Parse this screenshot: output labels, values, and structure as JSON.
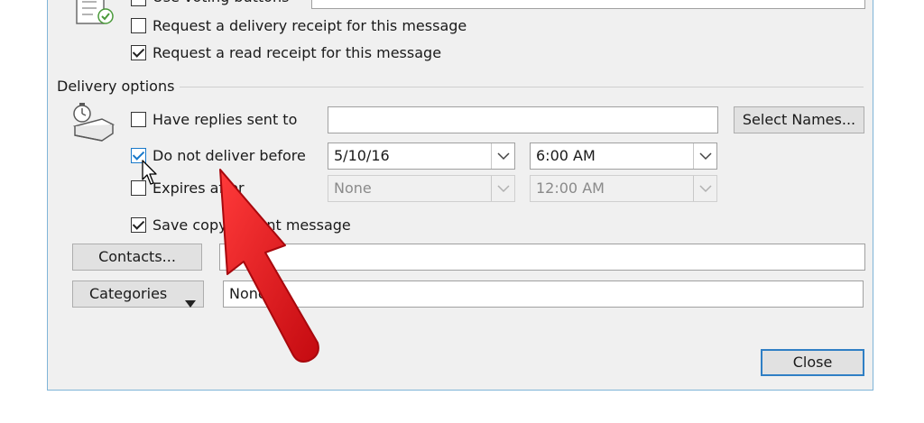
{
  "tracking": {
    "voting_label": "Use voting buttons",
    "delivery_receipt_label": "Request a delivery receipt for this message",
    "read_receipt_label": "Request a read receipt for this message"
  },
  "delivery": {
    "section_label": "Delivery options",
    "replies_label": "Have replies sent to",
    "replies_value": "",
    "select_names_label": "Select Names...",
    "not_before_label": "Do not deliver before",
    "not_before_date": "5/10/16",
    "not_before_time": "6:00 AM",
    "expires_label": "Expires after",
    "expires_date": "None",
    "expires_time": "12:00 AM",
    "save_copy_label": "Save copy of sent message"
  },
  "contacts": {
    "button_label": "Contacts...",
    "value": ""
  },
  "categories": {
    "button_label": "Categories",
    "value": "None"
  },
  "close_label": "Close",
  "colors": {
    "annotation_arrow": "#e8141c",
    "focus_blue": "#1979ca"
  }
}
